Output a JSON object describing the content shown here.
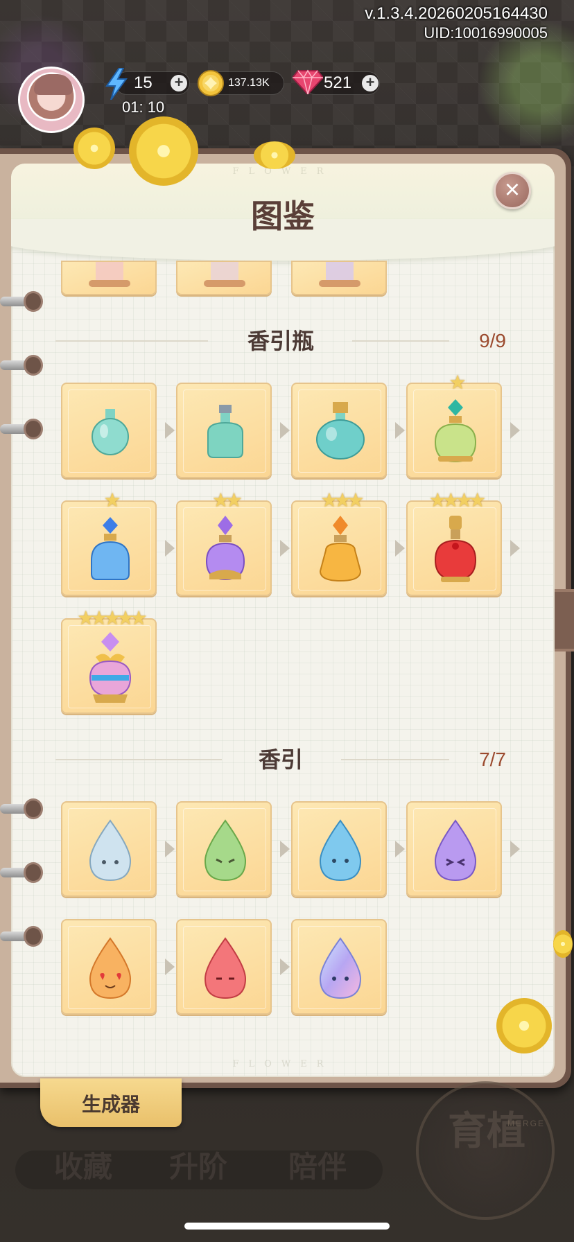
{
  "version": {
    "text": "v.1.3.4.20260205164430",
    "uid": "UID:10016990005"
  },
  "resources": {
    "energy": {
      "value": "15",
      "icon": "lightning-icon"
    },
    "coins": {
      "value": "137.13K",
      "icon": "coin-icon"
    },
    "gems": {
      "value": "521",
      "icon": "gem-icon"
    },
    "timer": "01: 10"
  },
  "panel": {
    "title": "图鉴",
    "flower_text": "FLOWER",
    "close_icon": "close-icon"
  },
  "sections": [
    {
      "title": "香引瓶",
      "count": "9/9",
      "items": [
        {
          "icon": "perfume-bottle-1-icon",
          "stars": ""
        },
        {
          "icon": "perfume-bottle-2-icon",
          "stars": ""
        },
        {
          "icon": "perfume-bottle-3-icon",
          "stars": ""
        },
        {
          "icon": "perfume-bottle-4-icon",
          "stars": "★"
        },
        {
          "icon": "perfume-bottle-5-icon",
          "stars": "★"
        },
        {
          "icon": "perfume-bottle-6-icon",
          "stars": "★★"
        },
        {
          "icon": "perfume-bottle-7-icon",
          "stars": "★★★"
        },
        {
          "icon": "perfume-bottle-8-icon",
          "stars": "★★★★"
        },
        {
          "icon": "perfume-bottle-9-icon",
          "stars": "★★★★★"
        }
      ]
    },
    {
      "title": "香引",
      "count": "7/7",
      "items": [
        {
          "icon": "drop-clear-icon"
        },
        {
          "icon": "drop-green-icon"
        },
        {
          "icon": "drop-blue-icon"
        },
        {
          "icon": "drop-purple-icon"
        },
        {
          "icon": "drop-orange-icon"
        },
        {
          "icon": "drop-red-icon"
        },
        {
          "icon": "drop-rainbow-icon"
        }
      ]
    }
  ],
  "generator_tab": "生成器",
  "nav": {
    "collect": "收藏",
    "upgrade": "升阶",
    "accompany": "陪伴",
    "start_big": "育植",
    "start_merge": "MERGE"
  },
  "colors": {
    "card_fill": "#fbd693",
    "title": "#5a3f38",
    "count": "#9b4a2e"
  }
}
